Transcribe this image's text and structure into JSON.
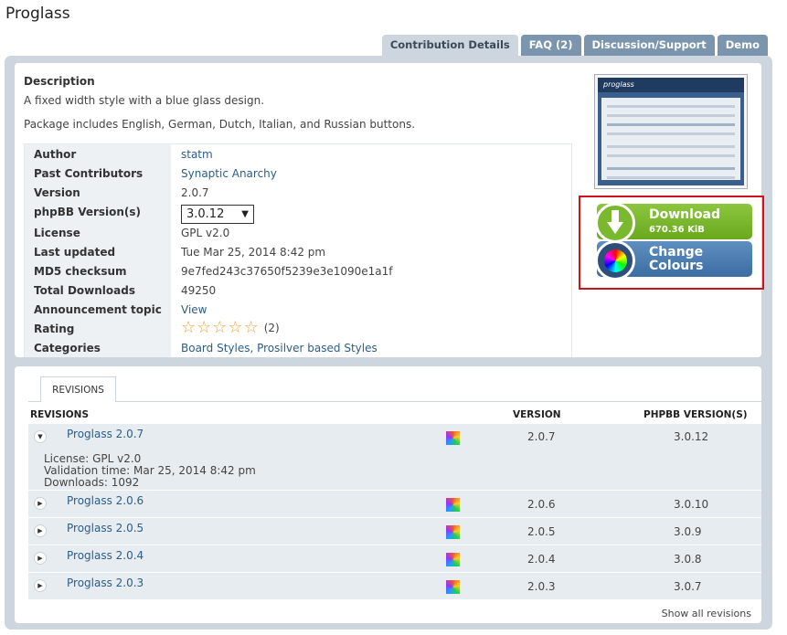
{
  "page_title": "Proglass",
  "tabs": [
    {
      "label": "Contribution Details",
      "active": true
    },
    {
      "label": "FAQ (2)"
    },
    {
      "label": "Discussion/Support"
    },
    {
      "label": "Demo"
    }
  ],
  "description": {
    "title": "Description",
    "line1": "A fixed width style with a blue glass design.",
    "line2": "Package includes English, German, Dutch, Italian, and Russian buttons."
  },
  "info": {
    "author_label": "Author",
    "author": "statm",
    "past_label": "Past Contributors",
    "past": "Synaptic Anarchy",
    "version_label": "Version",
    "version": "2.0.7",
    "phpbb_label": "phpBB Version(s)",
    "phpbb": "3.0.12",
    "license_label": "License",
    "license": "GPL v2.0",
    "updated_label": "Last updated",
    "updated": "Tue Mar 25, 2014 8:42 pm",
    "md5_label": "MD5 checksum",
    "md5": "9e7fed243c37650f5239e3e1090e1a1f",
    "downloads_label": "Total Downloads",
    "downloads": "49250",
    "announce_label": "Announcement topic",
    "announce": "View",
    "rating_label": "Rating",
    "rating_count": "(2)",
    "rating_stars": 0,
    "categories_label": "Categories",
    "categories": "Board Styles, Prosilver based Styles"
  },
  "thumbnail": {
    "logo": "proglass"
  },
  "download": {
    "label": "Download",
    "size": "670.36 KiB"
  },
  "change_colours": {
    "line1": "Change",
    "line2": "Colours"
  },
  "revisions": {
    "tab": "REVISIONS",
    "col_revisions": "REVISIONS",
    "col_version": "VERSION",
    "col_phpbb": "PHPBB VERSION(S)",
    "rows": [
      {
        "name": "Proglass 2.0.7",
        "version": "2.0.7",
        "phpbb": "3.0.12",
        "expanded": true,
        "license": "License: GPL v2.0",
        "validation": "Validation time: Mar 25, 2014 8:42 pm",
        "downloads": "Downloads: 1092"
      },
      {
        "name": "Proglass 2.0.6",
        "version": "2.0.6",
        "phpbb": "3.0.10"
      },
      {
        "name": "Proglass 2.0.5",
        "version": "2.0.5",
        "phpbb": "3.0.9"
      },
      {
        "name": "Proglass 2.0.4",
        "version": "2.0.4",
        "phpbb": "3.0.8"
      },
      {
        "name": "Proglass 2.0.3",
        "version": "2.0.3",
        "phpbb": "3.0.7"
      }
    ],
    "show_all": "Show all revisions"
  },
  "colors": {
    "tab": "#7a95ad",
    "panel": "#cdd6de",
    "download": "#7ab82e",
    "colours": "#3c6da3",
    "highlight": "#d0121b"
  }
}
